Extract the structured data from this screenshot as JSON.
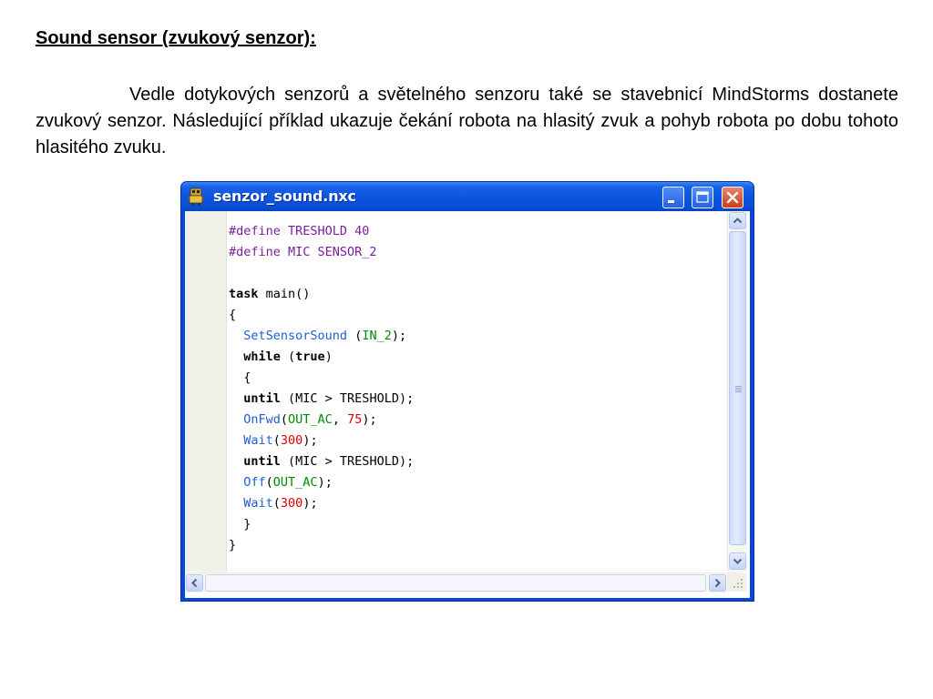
{
  "document": {
    "heading": "Sound sensor (zvukový senzor):",
    "paragraph": "Vedle dotykových senzorů a světelného senzoru také se stavebnicí MindStorms dostanete zvukový senzor. Následující příklad ukazuje čekání robota na hlasitý zvuk a pohyb robota po dobu tohoto hlasitého zvuku."
  },
  "window": {
    "title": "senzor_sound.nxc",
    "app_icon": "nxc-robot-icon",
    "buttons": [
      "minimize-icon",
      "maximize-icon",
      "close-icon"
    ]
  },
  "code": {
    "lines": [
      [
        {
          "t": "#define TRESHOLD 40",
          "c": "pp"
        }
      ],
      [
        {
          "t": "#define MIC SENSOR_2",
          "c": "pp"
        }
      ],
      [],
      [
        {
          "t": "task",
          "c": "kw"
        },
        {
          "t": " main()",
          "c": "pl"
        }
      ],
      [
        {
          "t": "{",
          "c": "pl"
        }
      ],
      [
        {
          "t": "  ",
          "c": "pl"
        },
        {
          "t": "SetSensorSound",
          "c": "fn"
        },
        {
          "t": " (",
          "c": "pl"
        },
        {
          "t": "IN_2",
          "c": "cn"
        },
        {
          "t": ");",
          "c": "pl"
        }
      ],
      [
        {
          "t": "  ",
          "c": "pl"
        },
        {
          "t": "while",
          "c": "kw"
        },
        {
          "t": " (",
          "c": "pl"
        },
        {
          "t": "true",
          "c": "kw"
        },
        {
          "t": ")",
          "c": "pl"
        }
      ],
      [
        {
          "t": "  {",
          "c": "pl"
        }
      ],
      [
        {
          "t": "  ",
          "c": "pl"
        },
        {
          "t": "until",
          "c": "kw"
        },
        {
          "t": " (MIC > TRESHOLD);",
          "c": "pl"
        }
      ],
      [
        {
          "t": "  ",
          "c": "pl"
        },
        {
          "t": "OnFwd",
          "c": "fn"
        },
        {
          "t": "(",
          "c": "pl"
        },
        {
          "t": "OUT_AC",
          "c": "cn"
        },
        {
          "t": ", ",
          "c": "pl"
        },
        {
          "t": "75",
          "c": "nm"
        },
        {
          "t": ");",
          "c": "pl"
        }
      ],
      [
        {
          "t": "  ",
          "c": "pl"
        },
        {
          "t": "Wait",
          "c": "fn"
        },
        {
          "t": "(",
          "c": "pl"
        },
        {
          "t": "300",
          "c": "nm"
        },
        {
          "t": ");",
          "c": "pl"
        }
      ],
      [
        {
          "t": "  ",
          "c": "pl"
        },
        {
          "t": "until",
          "c": "kw"
        },
        {
          "t": " (MIC > TRESHOLD);",
          "c": "pl"
        }
      ],
      [
        {
          "t": "  ",
          "c": "pl"
        },
        {
          "t": "Off",
          "c": "fn"
        },
        {
          "t": "(",
          "c": "pl"
        },
        {
          "t": "OUT_AC",
          "c": "cn"
        },
        {
          "t": ");",
          "c": "pl"
        }
      ],
      [
        {
          "t": "  ",
          "c": "pl"
        },
        {
          "t": "Wait",
          "c": "fn"
        },
        {
          "t": "(",
          "c": "pl"
        },
        {
          "t": "300",
          "c": "nm"
        },
        {
          "t": ");",
          "c": "pl"
        }
      ],
      [
        {
          "t": "  }",
          "c": "pl"
        }
      ],
      [
        {
          "t": "}",
          "c": "pl"
        }
      ]
    ]
  },
  "colors": {
    "preprocessor": "#7a1fa0",
    "function": "#1f5fd0",
    "constant": "#008a00",
    "number": "#e00000",
    "keyword": "#000000",
    "titlebar": "#0a54df"
  }
}
